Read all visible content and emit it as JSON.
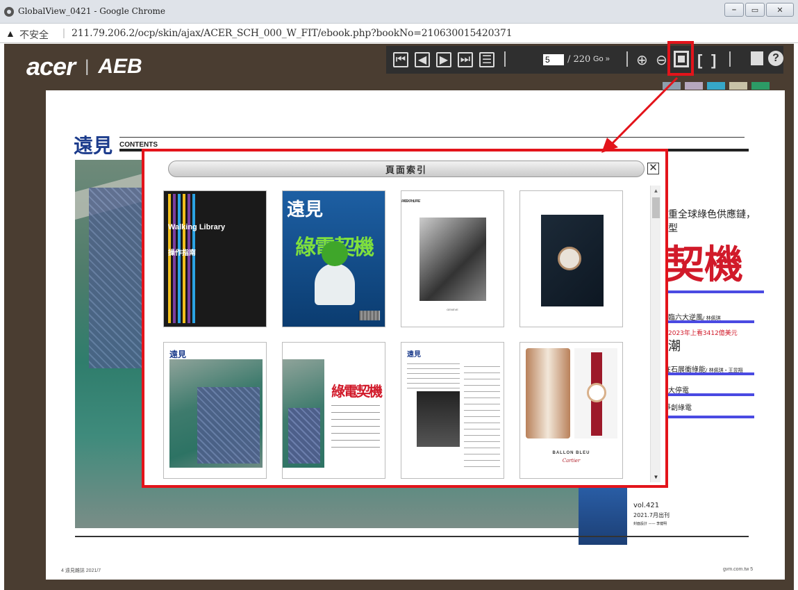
{
  "window": {
    "title": "GlobalView_0421 - Google Chrome",
    "minimize_label": "⎯",
    "restore_label": "▭",
    "close_label": "✕"
  },
  "addressbar": {
    "warning_icon": "warning-icon",
    "insecure_label": "不安全",
    "url": "211.79.206.2/ocp/skin/ajax/ACER_SCH_000_W_FIT/ebook.php?bookNo=210630015420371"
  },
  "brand": {
    "logo_text": "acer",
    "separator": "|",
    "aeb_text": "AEB"
  },
  "toolbar": {
    "current_page": "5",
    "total_pages": "/ 220",
    "go_label": "Go »",
    "zoom_in_icon": "zoom-in-icon",
    "zoom_out_icon": "zoom-out-icon",
    "page_index_icon": "page-index-icon",
    "print_icon": "print-icon",
    "help_label": "?"
  },
  "swatches": [
    "#8f9fae",
    "#b6a7bd",
    "#36a7c8",
    "#c8c2a7",
    "#2c9b66"
  ],
  "page": {
    "logo": "遠見",
    "contents_label": "CONTENTS",
    "footer_left": "4    遠見雜誌 2021/7",
    "footer_right": "gvm.com.tw    5",
    "right_headline_1": "重全球綠色供應鏈，",
    "right_headline_2": "型",
    "right_big_title": "契機",
    "item_1": "臨六大逆風",
    "item_1_author": "/ 林佩琪",
    "item_2": "2023年上看3412億美元",
    "item_3": "潮",
    "item_4": "在石展衝綠能",
    "item_4_author": "/ 林佩琪・王昱翔",
    "item_5": "大停電",
    "item_6": "爭創綠電",
    "vol": "vol.421",
    "issue_date": "2021.7月出刊",
    "credit": "封面設計 —— 李健明"
  },
  "dialog": {
    "title": "頁面索引",
    "close_label": "✕",
    "scroll_up": "▲",
    "scroll_down": "▼",
    "thumbs": [
      {
        "label": "Walking Library",
        "sub": "操作指南"
      },
      {
        "label": "遠見",
        "sub": "綠電契機"
      },
      {
        "label": "PATEK PHILIPPE",
        "sub": "GENEVE"
      },
      {
        "label": "",
        "sub": ""
      },
      {
        "label": "遠見",
        "sub": ""
      },
      {
        "label": "綠電契機",
        "sub": ""
      },
      {
        "label": "遠見",
        "sub": ""
      },
      {
        "label": "BALLON BLEU",
        "sub": "Cartier"
      }
    ]
  }
}
